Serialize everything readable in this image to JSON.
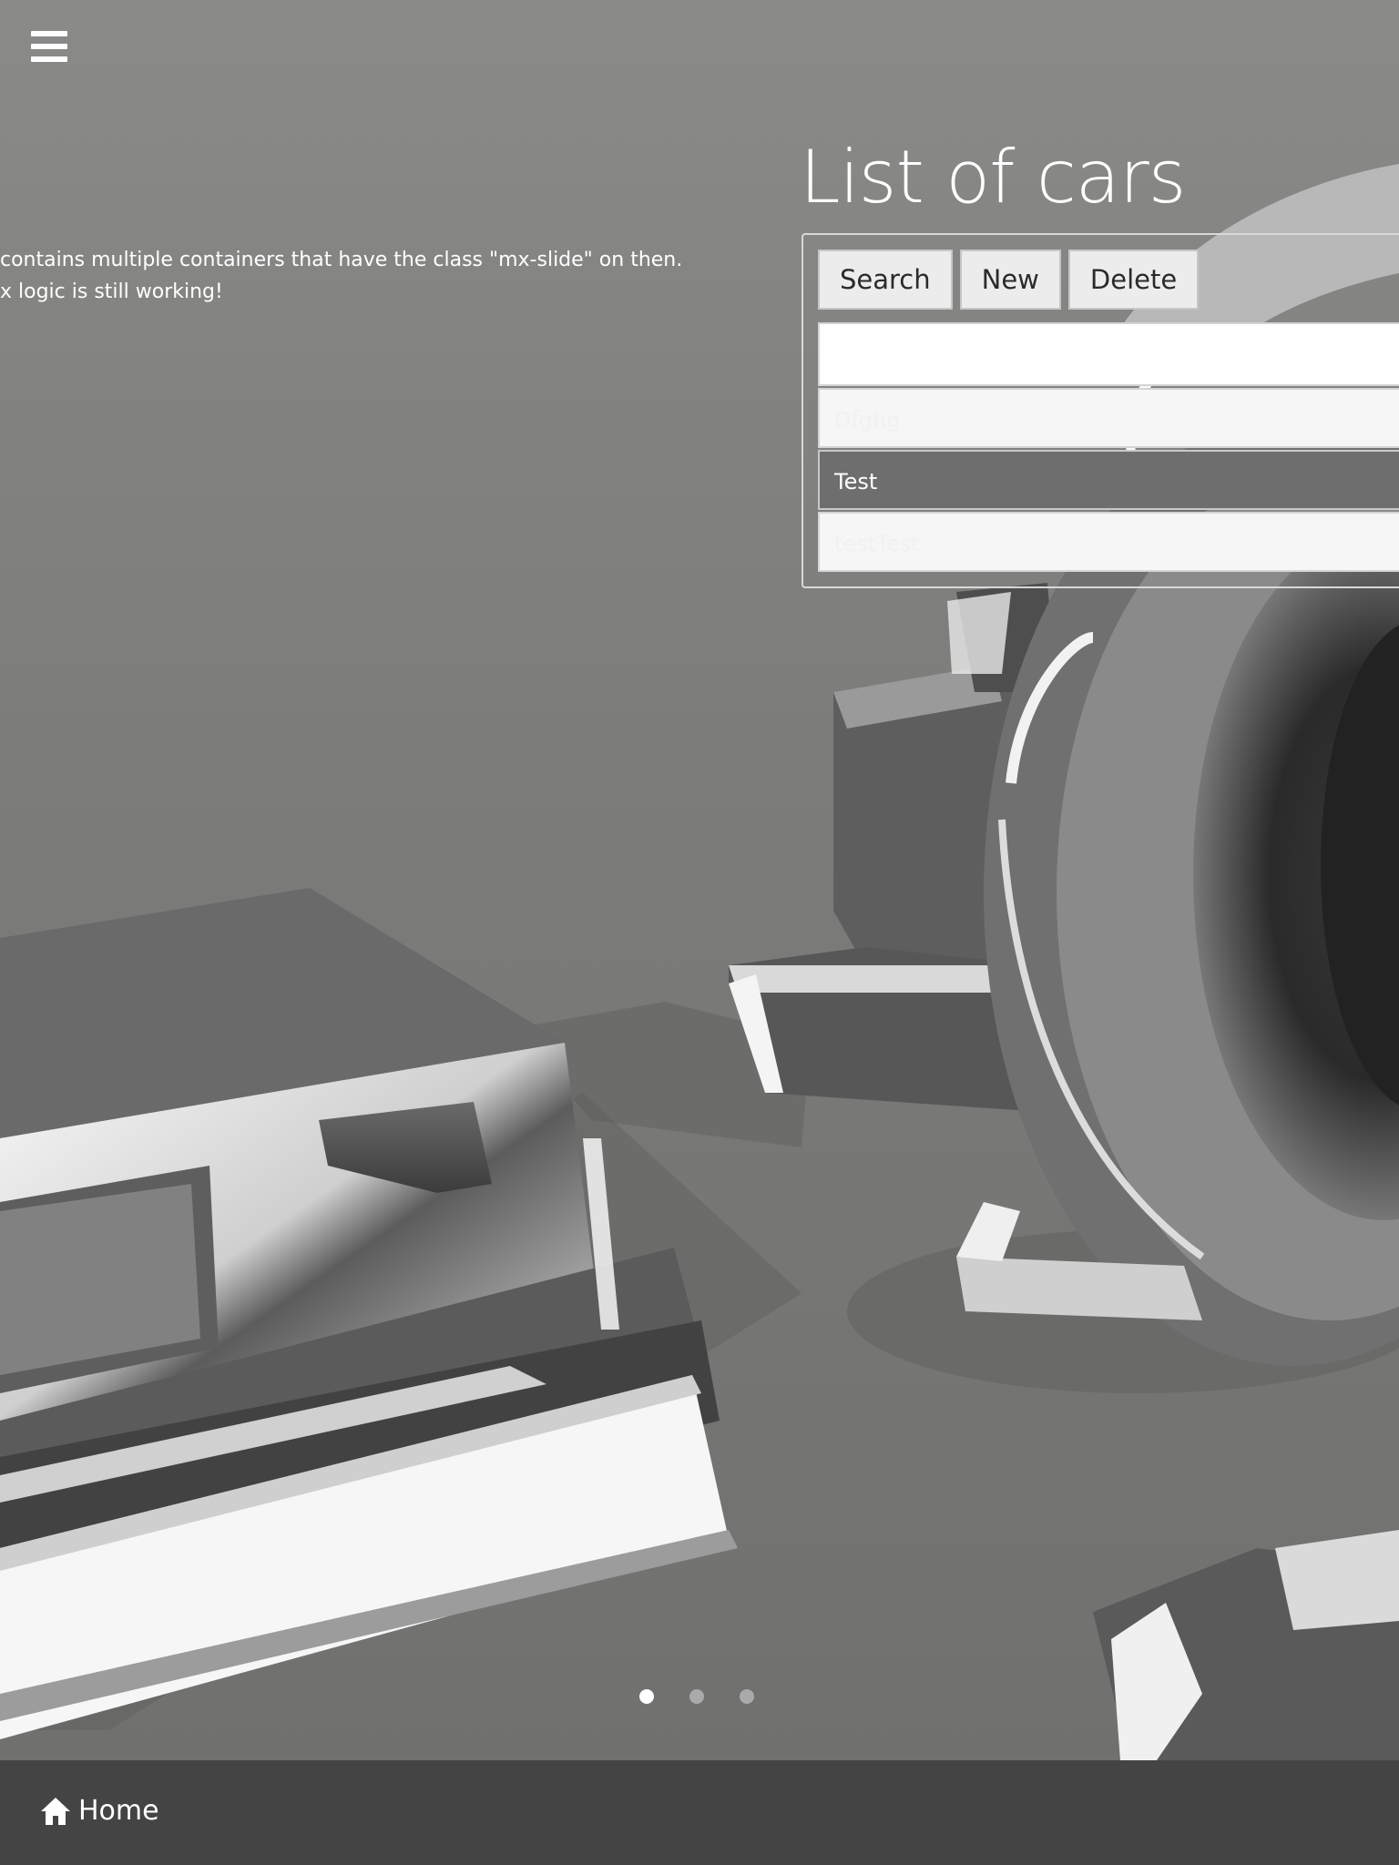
{
  "header": {
    "menu_icon": "hamburger-icon"
  },
  "slide": {
    "text_line1": "contains multiple containers that have the class \"mx-slide\" on then.",
    "text_line2": "x logic is still working!"
  },
  "cars_panel": {
    "title": "List of cars",
    "toolbar": {
      "search_label": "Search",
      "new_label": "New",
      "delete_label": "Delete"
    },
    "search": {
      "value": "",
      "placeholder": ""
    },
    "rows": [
      {
        "label": "Dfghg",
        "selected": false
      },
      {
        "label": "Test",
        "selected": true
      },
      {
        "label": "testTest",
        "selected": false
      }
    ]
  },
  "pager": {
    "count": 3,
    "active_index": 0
  },
  "bottom_bar": {
    "home_label": "Home",
    "home_icon": "home-icon"
  },
  "colors": {
    "bottom_bar": "#444444",
    "selected_row": "#6e6e6e",
    "button_bg": "#ececec"
  }
}
